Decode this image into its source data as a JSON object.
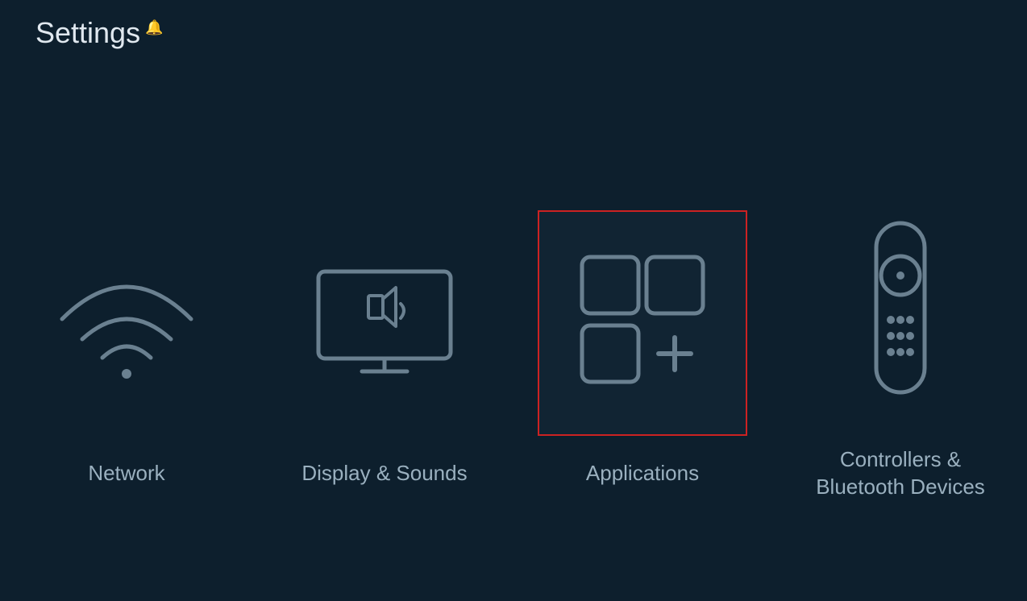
{
  "page": {
    "title": "Settings",
    "bell_icon": "🔔"
  },
  "items": [
    {
      "id": "network",
      "label": "Network",
      "selected": false
    },
    {
      "id": "display-sounds",
      "label": "Display & Sounds",
      "selected": false
    },
    {
      "id": "applications",
      "label": "Applications",
      "selected": true
    },
    {
      "id": "controllers-bluetooth",
      "label": "Controllers & Bluetooth Devices",
      "selected": false
    }
  ],
  "colors": {
    "background": "#0d1f2d",
    "icon_stroke": "#6a8090",
    "selected_border": "#cc2222",
    "text": "#9ab0bf",
    "title": "#e0e8ef"
  }
}
